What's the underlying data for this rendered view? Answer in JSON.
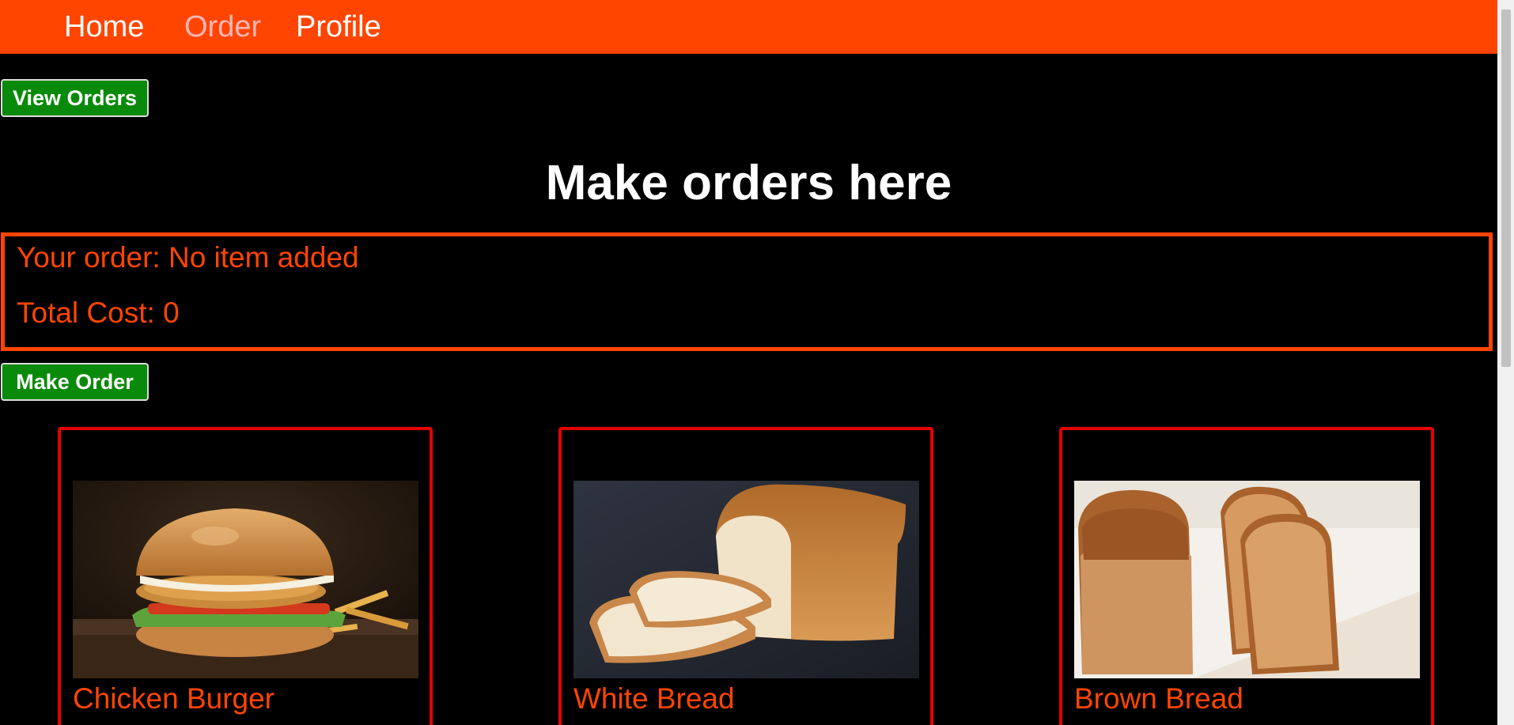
{
  "nav": {
    "items": [
      {
        "label": "Home"
      },
      {
        "label": "Order"
      },
      {
        "label": "Profile"
      }
    ]
  },
  "buttons": {
    "view_orders": "View Orders",
    "make_order": "Make Order"
  },
  "heading": "Make orders here",
  "order_summary": {
    "items_text": "Your order: No item added",
    "total_text": "Total Cost: 0"
  },
  "products": [
    {
      "name": "Chicken Burger"
    },
    {
      "name": "White Bread"
    },
    {
      "name": "Brown Bread"
    }
  ],
  "colors": {
    "navbar": "#ff4500",
    "accent": "#ff4500",
    "button": "#0a8a0a",
    "card_border": "#e60000",
    "background": "#000000"
  }
}
